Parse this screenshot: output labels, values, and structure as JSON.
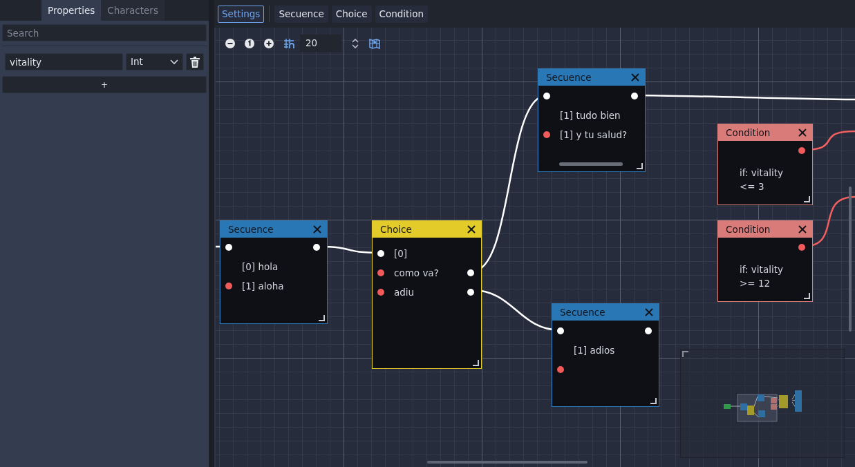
{
  "sidebar": {
    "tabs": [
      {
        "label": "Properties",
        "selected": true
      },
      {
        "label": "Characters",
        "selected": false
      }
    ],
    "search": {
      "placeholder": "Search"
    },
    "properties": [
      {
        "name": "vitality",
        "type": "Int"
      }
    ],
    "add_button": "+"
  },
  "toolbar": {
    "buttons": [
      {
        "label": "Settings",
        "selected": true
      },
      {
        "label": "Secuence",
        "selected": false
      },
      {
        "label": "Choice",
        "selected": false
      },
      {
        "label": "Condition",
        "selected": false
      }
    ]
  },
  "graph": {
    "snap_step": "20",
    "nodes": [
      {
        "kind": "sequence",
        "title": "Secuence",
        "rows": [
          {
            "in_port": {
              "color": "#ffffff"
            },
            "out_port": {
              "color": "#ffffff"
            }
          },
          {
            "text": "[0] hola"
          },
          {
            "text": "[1] aloha",
            "in_port": {
              "color": "#f05a5a"
            }
          }
        ]
      },
      {
        "kind": "choice",
        "title": "Choice",
        "rows": [
          {
            "text": "[0]",
            "in_port": {
              "color": "#ffffff"
            }
          },
          {
            "text": "como va?",
            "in_port": {
              "color": "#f05a5a"
            },
            "out_port": {
              "color": "#ffffff"
            }
          },
          {
            "text": "adiu",
            "in_port": {
              "color": "#f05a5a"
            },
            "out_port": {
              "color": "#ffffff"
            }
          }
        ]
      },
      {
        "kind": "sequence",
        "title": "Secuence",
        "rows": [
          {
            "in_port": {
              "color": "#ffffff"
            },
            "out_port": {
              "color": "#ffffff"
            }
          },
          {
            "text": "[1] tudo bien"
          },
          {
            "text": "[1] y tu salud?",
            "in_port": {
              "color": "#f05a5a"
            }
          }
        ]
      },
      {
        "kind": "condition",
        "title": "Condition",
        "rows": [
          {
            "out_port": {
              "color": "#f05a5a"
            }
          },
          {
            "text": "if: vitality <= 3"
          }
        ]
      },
      {
        "kind": "condition",
        "title": "Condition",
        "rows": [
          {
            "out_port": {
              "color": "#f05a5a"
            }
          },
          {
            "text": "if: vitality >= 12"
          }
        ]
      },
      {
        "kind": "sequence",
        "title": "Secuence",
        "rows": [
          {
            "in_port": {
              "color": "#ffffff"
            },
            "out_port": {
              "color": "#ffffff"
            }
          },
          {
            "text": "[1] adios"
          },
          {
            "in_port": {
              "color": "#f05a5a"
            }
          }
        ]
      }
    ]
  }
}
